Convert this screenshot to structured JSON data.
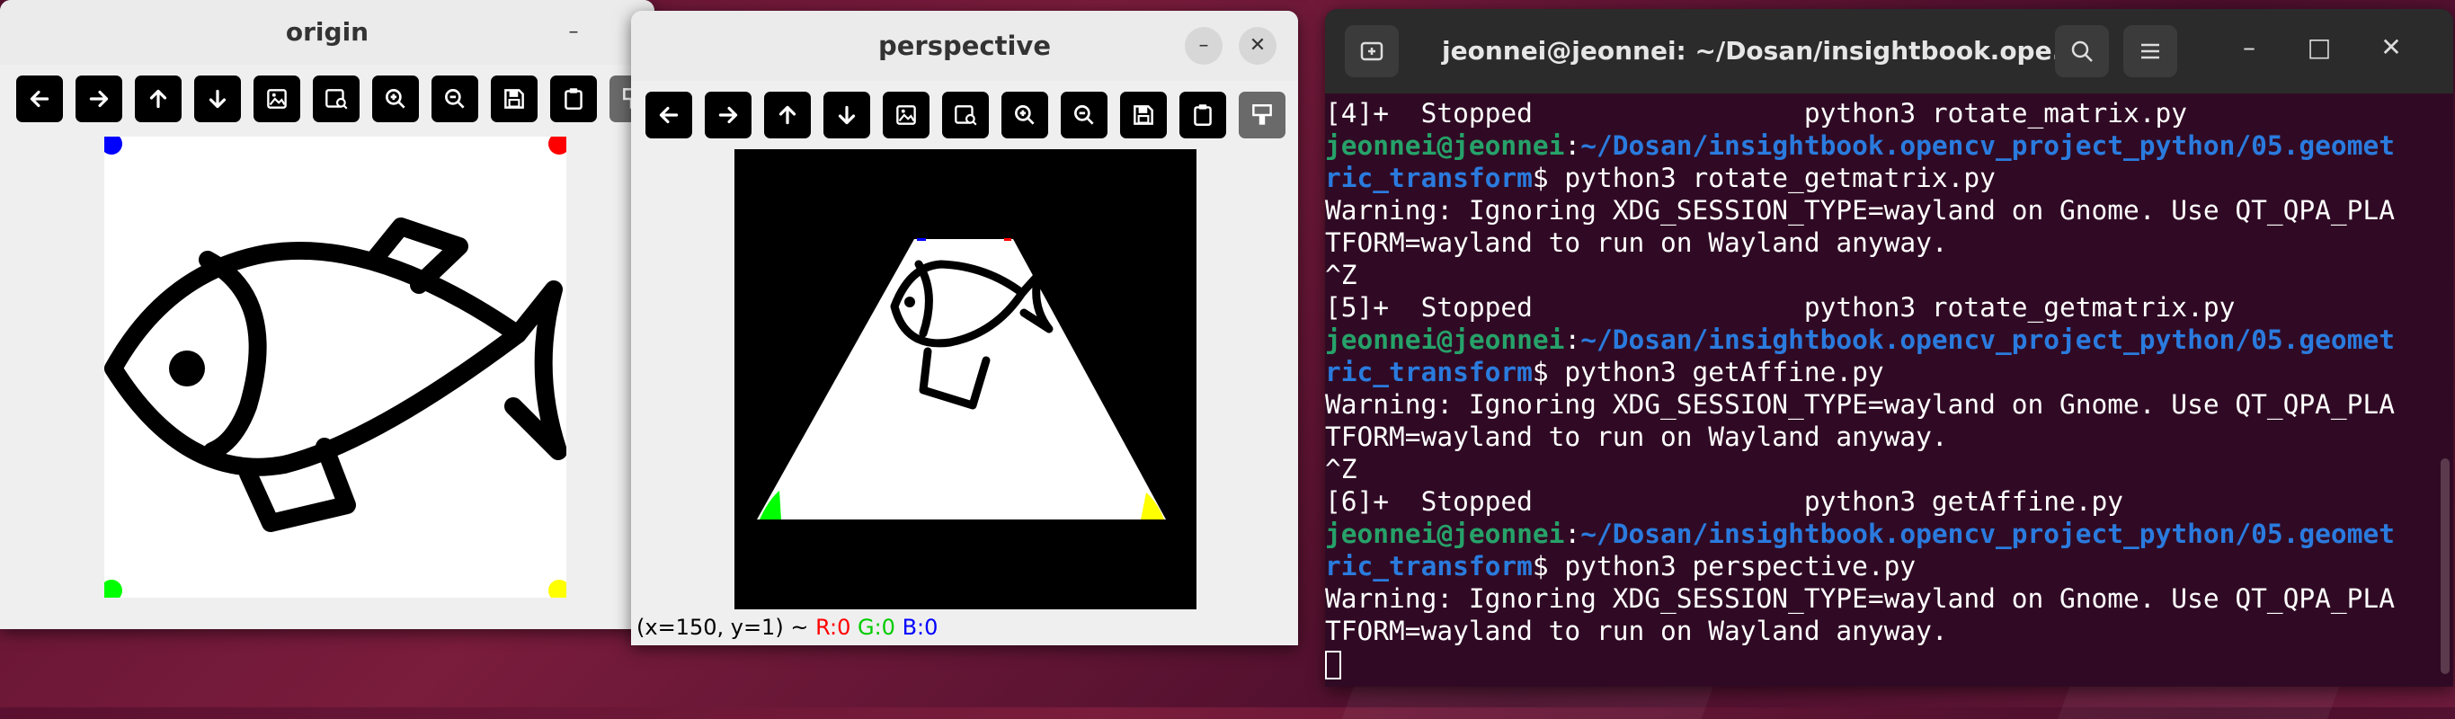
{
  "origin_window": {
    "title": "origin",
    "minimize": "–"
  },
  "perspective_window": {
    "title": "perspective",
    "minimize": "–",
    "close": "✕",
    "status": {
      "coords": "(x=150, y=1) ~ ",
      "r": "R:0",
      "g": "G:0",
      "b": "B:0"
    }
  },
  "toolbar_icons": [
    "arrow-left-icon",
    "arrow-right-icon",
    "arrow-up-icon",
    "arrow-down-icon",
    "image-icon",
    "image-search-icon",
    "zoom-in-icon",
    "zoom-out-icon",
    "save-icon",
    "clipboard-icon",
    "settings-icon"
  ],
  "terminal": {
    "title": "jeonnei@jeonnei: ~/Dosan/insightbook.ope...",
    "minimize": "–",
    "maximize": "□",
    "close": "✕",
    "lines": [
      {
        "parts": [
          {
            "c": "w",
            "t": "[4]+  Stopped                 python3 rotate_matrix.py"
          }
        ]
      },
      {
        "parts": [
          {
            "c": "g",
            "t": "jeonnei@jeonnei"
          },
          {
            "c": "w",
            "t": ":"
          },
          {
            "c": "b",
            "t": "~/Dosan/insightbook.opencv_project_python/05.geomet"
          }
        ]
      },
      {
        "parts": [
          {
            "c": "b",
            "t": "ric_transform"
          },
          {
            "c": "w",
            "t": "$ python3 rotate_getmatrix.py"
          }
        ]
      },
      {
        "parts": [
          {
            "c": "w",
            "t": "Warning: Ignoring XDG_SESSION_TYPE=wayland on Gnome. Use QT_QPA_PLA"
          }
        ]
      },
      {
        "parts": [
          {
            "c": "w",
            "t": "TFORM=wayland to run on Wayland anyway."
          }
        ]
      },
      {
        "parts": [
          {
            "c": "w",
            "t": "^Z"
          }
        ]
      },
      {
        "parts": [
          {
            "c": "w",
            "t": "[5]+  Stopped                 python3 rotate_getmatrix.py"
          }
        ]
      },
      {
        "parts": [
          {
            "c": "g",
            "t": "jeonnei@jeonnei"
          },
          {
            "c": "w",
            "t": ":"
          },
          {
            "c": "b",
            "t": "~/Dosan/insightbook.opencv_project_python/05.geomet"
          }
        ]
      },
      {
        "parts": [
          {
            "c": "b",
            "t": "ric_transform"
          },
          {
            "c": "w",
            "t": "$ python3 getAffine.py"
          }
        ]
      },
      {
        "parts": [
          {
            "c": "w",
            "t": "Warning: Ignoring XDG_SESSION_TYPE=wayland on Gnome. Use QT_QPA_PLA"
          }
        ]
      },
      {
        "parts": [
          {
            "c": "w",
            "t": "TFORM=wayland to run on Wayland anyway."
          }
        ]
      },
      {
        "parts": [
          {
            "c": "w",
            "t": "^Z"
          }
        ]
      },
      {
        "parts": [
          {
            "c": "w",
            "t": "[6]+  Stopped                 python3 getAffine.py"
          }
        ]
      },
      {
        "parts": [
          {
            "c": "g",
            "t": "jeonnei@jeonnei"
          },
          {
            "c": "w",
            "t": ":"
          },
          {
            "c": "b",
            "t": "~/Dosan/insightbook.opencv_project_python/05.geomet"
          }
        ]
      },
      {
        "parts": [
          {
            "c": "b",
            "t": "ric_transform"
          },
          {
            "c": "w",
            "t": "$ python3 perspective.py"
          }
        ]
      },
      {
        "parts": [
          {
            "c": "w",
            "t": "Warning: Ignoring XDG_SESSION_TYPE=wayland on Gnome. Use QT_QPA_PLA"
          }
        ]
      },
      {
        "parts": [
          {
            "c": "w",
            "t": "TFORM=wayland to run on Wayland anyway."
          }
        ]
      }
    ]
  },
  "colors": {
    "prompt_user": "#26a269",
    "prompt_path": "#2a7bde",
    "terminal_bg": "#300a24",
    "status_r": "#ff0000",
    "status_g": "#00cc00",
    "status_b": "#0000ff"
  }
}
